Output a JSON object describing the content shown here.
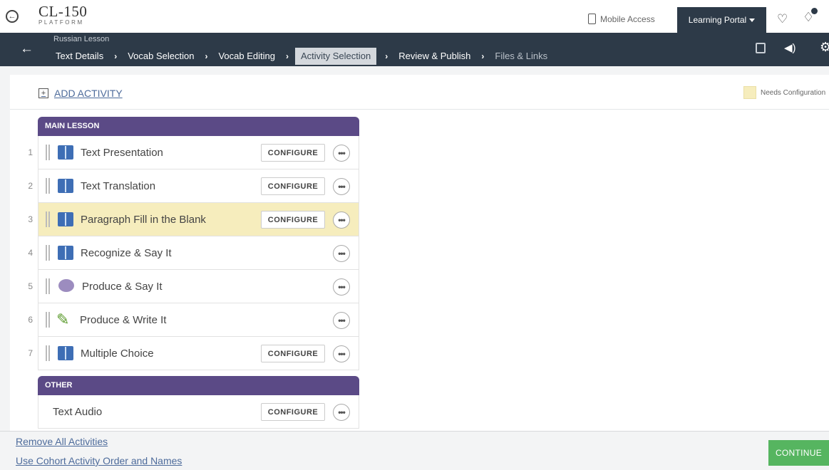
{
  "brand": {
    "title": "CL-150",
    "subtitle": "PLATFORM"
  },
  "topbar": {
    "mobile_access": "Mobile Access",
    "portal_label": "Learning Portal"
  },
  "nav": {
    "lesson_name": "Russian Lesson",
    "crumbs": [
      "Text Details",
      "Vocab Selection",
      "Vocab Editing",
      "Activity Selection",
      "Review & Publish",
      "Files & Links"
    ],
    "active_index": 3
  },
  "toolbar": {
    "add_activity": "ADD ACTIVITY",
    "legend_label": "Needs Configuration",
    "legend_color": "#f6edbd"
  },
  "main_lesson": {
    "header": "MAIN LESSON",
    "rows": [
      {
        "num": "1",
        "label": "Text Presentation",
        "icon": "book-icon",
        "configure": "CONFIGURE"
      },
      {
        "num": "2",
        "label": "Text Translation",
        "icon": "book-icon",
        "configure": "CONFIGURE"
      },
      {
        "num": "3",
        "label": "Paragraph Fill in the Blank",
        "icon": "book-icon",
        "configure": "CONFIGURE",
        "needs_configuration": true
      },
      {
        "num": "4",
        "label": "Recognize & Say It",
        "icon": "book-icon"
      },
      {
        "num": "5",
        "label": "Produce & Say It",
        "icon": "speech-bubble-icon"
      },
      {
        "num": "6",
        "label": "Produce & Write It",
        "icon": "pencil-icon"
      },
      {
        "num": "7",
        "label": "Multiple Choice",
        "icon": "book-icon",
        "configure": "CONFIGURE"
      }
    ]
  },
  "other": {
    "header": "OTHER",
    "rows": [
      {
        "label": "Text Audio",
        "configure": "CONFIGURE"
      }
    ]
  },
  "footer": {
    "remove_all": "Remove All Activities",
    "use_cohort": "Use Cohort Activity Order and Names",
    "continue": "CONTINUE"
  },
  "colors": {
    "nav_bg": "#2d3a48",
    "section_header": "#5b4a86",
    "highlight": "#f6edbd",
    "continue": "#56b560",
    "link": "#4d6b9b"
  }
}
